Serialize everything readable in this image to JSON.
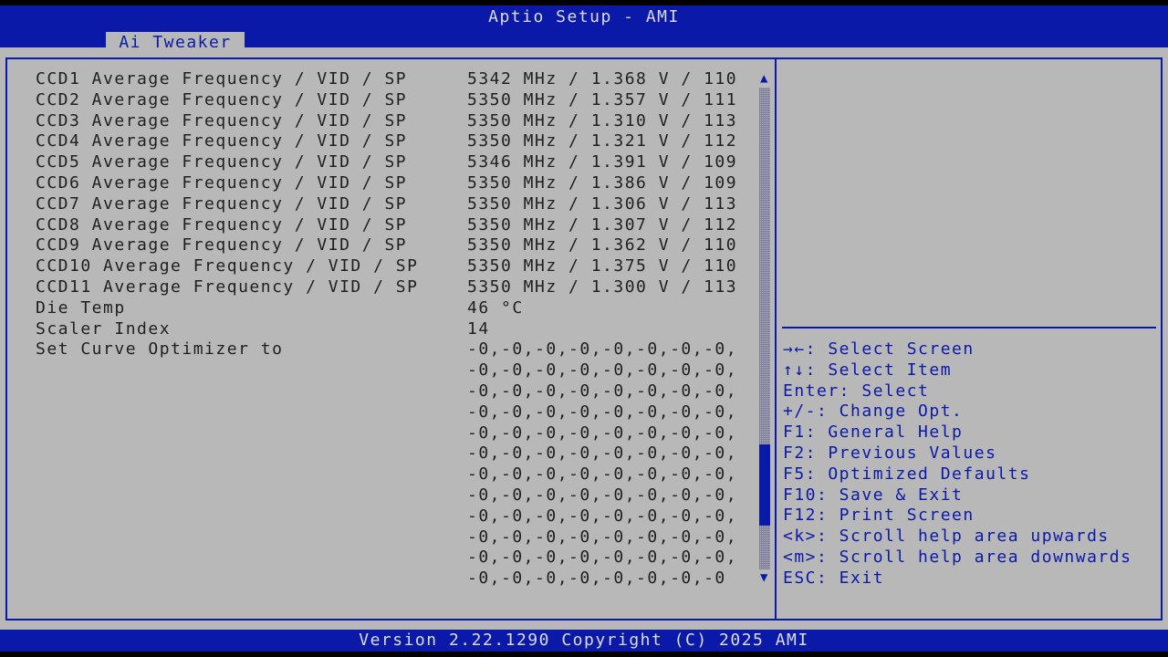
{
  "window": {
    "title": "Aptio Setup - AMI",
    "active_tab": "Ai Tweaker",
    "footer": "Version 2.22.1290 Copyright (C) 2025 AMI"
  },
  "colors": {
    "header_blue": "#0a19a8",
    "panel_gray": "#b8b8b8",
    "text_dark": "#1f1f1f",
    "text_light": "#dcdcdc"
  },
  "settings": [
    {
      "label": "CCD1 Average Frequency / VID / SP",
      "value": "5342 MHz / 1.368 V / 110"
    },
    {
      "label": "CCD2 Average Frequency / VID / SP",
      "value": "5350 MHz / 1.357 V / 111"
    },
    {
      "label": "CCD3 Average Frequency / VID / SP",
      "value": "5350 MHz / 1.310 V / 113"
    },
    {
      "label": "CCD4 Average Frequency / VID / SP",
      "value": "5350 MHz / 1.321 V / 112"
    },
    {
      "label": "CCD5 Average Frequency / VID / SP",
      "value": "5346 MHz / 1.391 V / 109"
    },
    {
      "label": "CCD6 Average Frequency / VID / SP",
      "value": "5350 MHz / 1.386 V / 109"
    },
    {
      "label": "CCD7 Average Frequency / VID / SP",
      "value": "5350 MHz / 1.306 V / 113"
    },
    {
      "label": "CCD8 Average Frequency / VID / SP",
      "value": "5350 MHz / 1.307 V / 112"
    },
    {
      "label": "CCD9 Average Frequency / VID / SP",
      "value": "5350 MHz / 1.362 V / 110"
    },
    {
      "label": "CCD10 Average Frequency / VID / SP",
      "value": "5350 MHz / 1.375 V / 110"
    },
    {
      "label": "CCD11 Average Frequency / VID / SP",
      "value": "5350 MHz / 1.300 V / 113"
    },
    {
      "label": "Die Temp",
      "value": "46 °C"
    },
    {
      "label": "Scaler Index",
      "value": "14"
    },
    {
      "label": "Set Curve Optimizer to",
      "value": "-0,-0,-0,-0,-0,-0,-0,-0,"
    }
  ],
  "curve_optimizer_lines": [
    "-0,-0,-0,-0,-0,-0,-0,-0,",
    "-0,-0,-0,-0,-0,-0,-0,-0,",
    "-0,-0,-0,-0,-0,-0,-0,-0,",
    "-0,-0,-0,-0,-0,-0,-0,-0,",
    "-0,-0,-0,-0,-0,-0,-0,-0,",
    "-0,-0,-0,-0,-0,-0,-0,-0,",
    "-0,-0,-0,-0,-0,-0,-0,-0,",
    "-0,-0,-0,-0,-0,-0,-0,-0,",
    "-0,-0,-0,-0,-0,-0,-0,-0,",
    "-0,-0,-0,-0,-0,-0,-0,-0,",
    "-0,-0,-0,-0,-0,-0,-0,-0"
  ],
  "scrollbar": {
    "up_icon": "▲",
    "down_icon": "▼",
    "thumb_start_fraction": 0.74,
    "thumb_end_fraction": 0.91
  },
  "help_keys": [
    {
      "icon": "left-right-arrow-icon",
      "text": "→←: Select Screen"
    },
    {
      "icon": "up-down-arrow-icon",
      "text": "↑↓: Select Item"
    },
    {
      "text": "Enter: Select"
    },
    {
      "text": "+/-: Change Opt."
    },
    {
      "text": "F1: General Help"
    },
    {
      "text": "F2: Previous Values"
    },
    {
      "text": "F5: Optimized Defaults"
    },
    {
      "text": "F10: Save & Exit"
    },
    {
      "text": "F12: Print Screen"
    },
    {
      "text": "<k>: Scroll help area upwards"
    },
    {
      "text": "<m>: Scroll help area downwards"
    },
    {
      "text": "ESC: Exit"
    }
  ]
}
